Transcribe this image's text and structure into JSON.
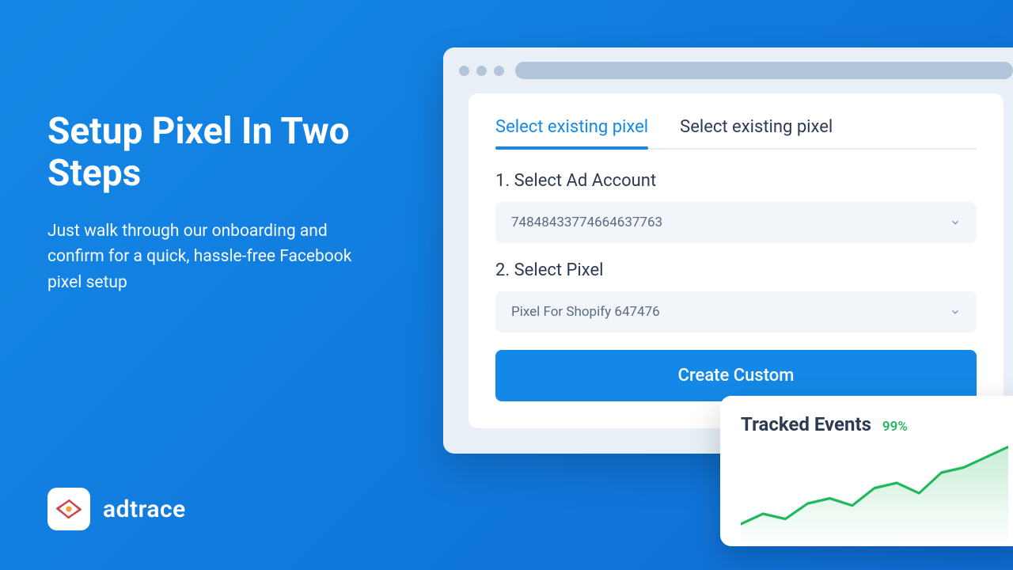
{
  "headline": "Setup Pixel In Two Steps",
  "subheadline": "Just walk through our onboarding and confirm for a quick, hassle-free Facebook pixel setup",
  "brand": {
    "name": "adtrace"
  },
  "tabs": {
    "active": "Select existing pixel",
    "inactive": "Select existing pixel"
  },
  "step1": {
    "label": "1. Select Ad Account",
    "value": "74848433774664637763"
  },
  "step2": {
    "label": "2. Select Pixel",
    "value": "Pixel For Shopify 647476"
  },
  "cta": "Create Custom",
  "events": {
    "title": "Tracked Events",
    "percent": "99%"
  },
  "chart_data": {
    "type": "line",
    "title": "Tracked Events",
    "values": [
      20,
      30,
      25,
      40,
      45,
      38,
      55,
      60,
      50,
      70,
      75,
      85,
      95
    ],
    "ylim": [
      0,
      100
    ]
  }
}
